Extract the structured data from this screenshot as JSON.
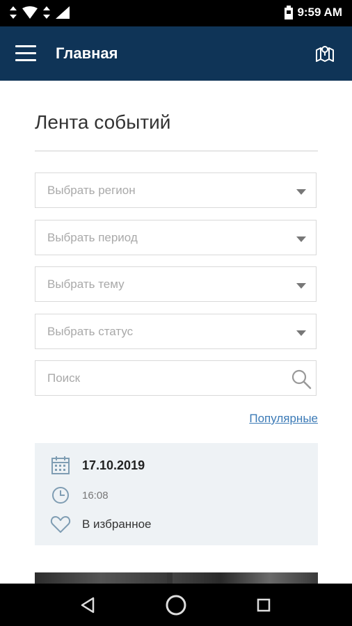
{
  "status_bar": {
    "time": "9:59 AM",
    "icons": [
      "data-arrows-icon",
      "wifi-icon",
      "data-arrows-icon",
      "signal-icon",
      "battery-icon"
    ]
  },
  "app_bar": {
    "title": "Главная",
    "menu_icon": "hamburger-menu-icon",
    "map_icon": "map-icon"
  },
  "feed": {
    "title": "Лента событий",
    "filters": [
      {
        "placeholder": "Выбрать регион"
      },
      {
        "placeholder": "Выбрать период"
      },
      {
        "placeholder": "Выбрать тему"
      },
      {
        "placeholder": "Выбрать статус"
      }
    ],
    "search": {
      "placeholder": "Поиск"
    },
    "popular_link": "Популярные"
  },
  "event_card": {
    "date": "17.10.2019",
    "time": "16:08",
    "favorite_label": "В избранное"
  },
  "colors": {
    "app_bar": "#0f3457",
    "link": "#3b7ab6",
    "card_bg": "#eef2f5"
  },
  "nav_bar": {
    "buttons": [
      "back-icon",
      "home-icon",
      "recents-icon"
    ]
  }
}
